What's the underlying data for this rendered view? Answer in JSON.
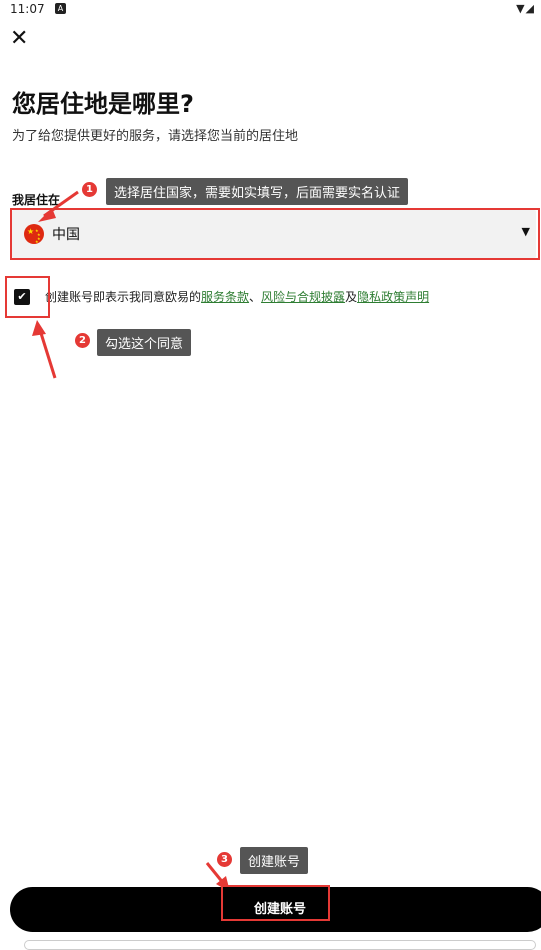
{
  "status": {
    "time": "11:07",
    "notif_icon": "A",
    "signal": "▼◢"
  },
  "page": {
    "title": "您居住地是哪里?",
    "subtitle": "为了给您提供更好的服务，请选择您当前的居住地",
    "residence_label": "我居住在"
  },
  "select": {
    "value": "中国",
    "flag": "china-flag-icon"
  },
  "consent": {
    "prefix": "创建账号即表示我同意欧易的",
    "link1": "服务条款",
    "sep1": "、",
    "link2": "风险与合规披露",
    "sep2": "及",
    "link3": "隐私政策声明",
    "checked": true
  },
  "annotations": {
    "step1_num": "1",
    "step1_text": "选择居住国家，需要如实填写，后面需要实名认证",
    "step2_num": "2",
    "step2_text": "勾选这个同意",
    "step3_num": "3",
    "step3_text": "创建账号"
  },
  "button": {
    "create_label": "创建账号"
  },
  "colors": {
    "accent_red": "#e53935",
    "link_green": "#2e7d32",
    "button_black": "#000000",
    "tip_gray": "#555555"
  }
}
